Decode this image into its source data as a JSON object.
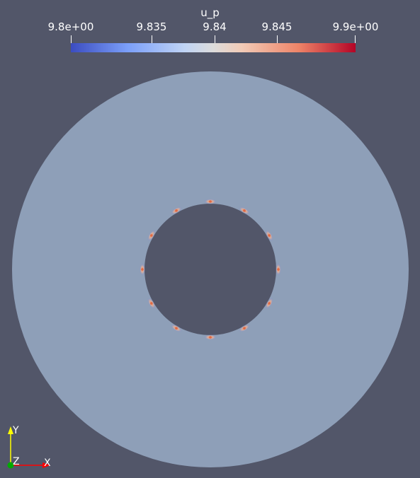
{
  "colorbar": {
    "title": "u_p",
    "labels": [
      "9.8e+00",
      "9.835",
      "9.84",
      "9.845",
      "9.9e+00"
    ],
    "colormap": [
      "#3b4cc0",
      "#dddcdc",
      "#b40426"
    ]
  },
  "scene": {
    "background": "#525669",
    "annulus_fill": "#8e9fb8",
    "hotspot_count": 12
  },
  "orientation_axes": {
    "y_label": "Y",
    "z_label": "Z",
    "x_label": "X",
    "y_color": "#ffff00",
    "x_color": "#ff0000",
    "z_color": "#00aa00"
  }
}
